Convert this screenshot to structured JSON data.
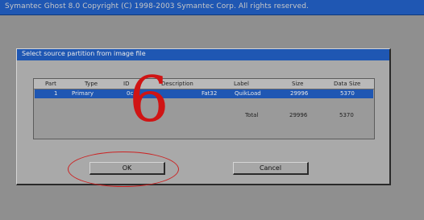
{
  "top_bar": {
    "title": "Symantec Ghost 8.0    Copyright (C) 1998-2003 Symantec Corp. All rights reserved."
  },
  "dialog": {
    "title": "Select source partition from image file",
    "table": {
      "headers": [
        "Part",
        "Type",
        "ID",
        "Description",
        "Label",
        "Size",
        "Data Size"
      ],
      "selected_row": [
        "1",
        "Primary",
        "0c",
        "Fat32",
        "QuikLoad",
        "29996",
        "5370"
      ],
      "total_row": {
        "label": "Total",
        "size": "29996",
        "data_size": "5370"
      }
    },
    "buttons": {
      "ok": "OK",
      "cancel": "Cancel"
    }
  },
  "annotation": {
    "number": "6",
    "color": "#d01414"
  }
}
